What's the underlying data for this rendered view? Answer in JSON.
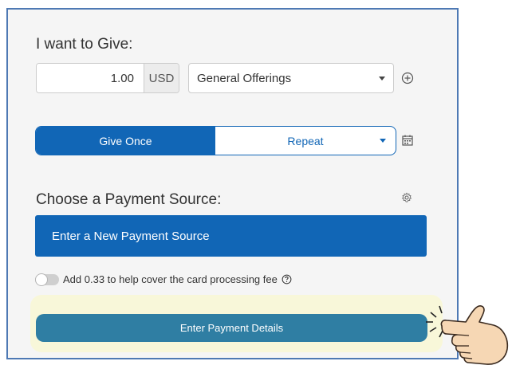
{
  "give": {
    "heading": "I want to Give:",
    "amount_value": "1.00",
    "currency": "USD",
    "fund_selected": "General Offerings"
  },
  "frequency": {
    "once_label": "Give Once",
    "repeat_label": "Repeat",
    "selected": "Give Once"
  },
  "payment": {
    "heading": "Choose a Payment Source:",
    "new_source_label": "Enter a New Payment Source"
  },
  "fee": {
    "label": "Add 0.33 to help cover the card processing fee",
    "toggle_on": false
  },
  "submit": {
    "label": "Enter Payment Details"
  },
  "icons": {
    "add_fund": "plus-circle-icon",
    "schedule": "calendar-icon",
    "settings": "gear-icon",
    "help": "question-circle-icon",
    "pointer": "pointing-hand-icon"
  },
  "colors": {
    "primary": "#1166b6",
    "submit": "#2f7ea3",
    "highlight": "#f8f7d9",
    "frame": "#4e79b4"
  }
}
